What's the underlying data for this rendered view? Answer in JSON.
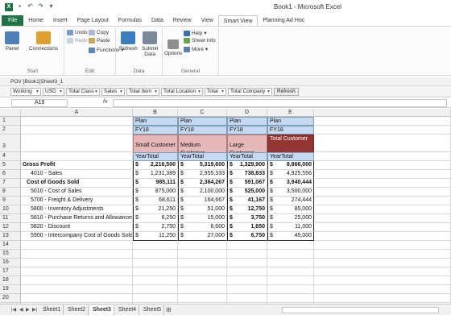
{
  "window": {
    "title": "Book1 - Microsoft Excel"
  },
  "ribbon_tabs": [
    "File",
    "Home",
    "Insert",
    "Page Layout",
    "Formulas",
    "Data",
    "Review",
    "View",
    "Smart View",
    "Planning Ad Hoc"
  ],
  "ribbon": {
    "start": {
      "label": "Start",
      "panel": "Panel",
      "connections": "Connections"
    },
    "edit": {
      "label": "Edit",
      "undo": "Undo",
      "redo": "Redo",
      "copy": "Copy",
      "paste": "Paste",
      "functions": "Functions"
    },
    "data": {
      "label": "Data",
      "refresh": "Refresh",
      "submit": "Submit",
      "submit2": "Data"
    },
    "general": {
      "label": "General",
      "options": "Options",
      "help": "Help",
      "sheet_info": "Sheet Info",
      "more": "More"
    }
  },
  "pov_label": "POV [Book1]Sheet3_1",
  "pov_dims": [
    "Working",
    "USD",
    "Total Class",
    "Sales",
    "Total Item",
    "Total Location",
    "Total",
    "Total Company"
  ],
  "pov_refresh": "Refresh",
  "name_box": "A19",
  "fx": "fx",
  "columns": [
    "A",
    "B",
    "C",
    "D",
    "E"
  ],
  "rows": [
    "1",
    "2",
    "3",
    "4",
    "5",
    "6",
    "7",
    "8",
    "9",
    "10",
    "11",
    "12",
    "13",
    "14",
    "15",
    "16",
    "17",
    "18",
    "19",
    "20",
    "21"
  ],
  "header": {
    "scenario": [
      "Plan",
      "Plan",
      "Plan",
      "Plan"
    ],
    "year": [
      "FY18",
      "FY18",
      "FY18",
      "FY18"
    ],
    "customer": [
      "Small Customer",
      "Medium Customer",
      "Large Customer",
      "Total Customer"
    ],
    "period": [
      "YearTotal",
      "YearTotal",
      "YearTotal",
      "YearTotal"
    ]
  },
  "data_rows": [
    {
      "label": "Gross Profit",
      "bold": true,
      "indent": 0,
      "values": [
        "2,216,500",
        "5,319,600",
        "1,329,900",
        "8,866,000"
      ]
    },
    {
      "label": "4010 - Sales",
      "bold": false,
      "indent": 2,
      "values": [
        "1,231,389",
        "2,955,333",
        "738,833",
        "4,925,556"
      ]
    },
    {
      "label": "Cost of Goods Sold",
      "bold": true,
      "indent": 1,
      "values": [
        "985,111",
        "2,364,267",
        "591,067",
        "3,940,444"
      ]
    },
    {
      "label": "5010 - Cost of Sales",
      "bold": false,
      "indent": 2,
      "values": [
        "875,000",
        "2,100,000",
        "525,000",
        "3,500,000"
      ]
    },
    {
      "label": "5700 - Freight & Delivery",
      "bold": false,
      "indent": 2,
      "values": [
        "68,611",
        "164,667",
        "41,167",
        "274,444"
      ]
    },
    {
      "label": "5800 - Inventory Adjustments",
      "bold": false,
      "indent": 2,
      "values": [
        "21,250",
        "51,000",
        "12,750",
        "85,000"
      ]
    },
    {
      "label": "5810 - Purchase Returns and Allowances",
      "bold": false,
      "indent": 2,
      "values": [
        "6,250",
        "15,000",
        "3,750",
        "25,000"
      ]
    },
    {
      "label": "5820 - Discount",
      "bold": false,
      "indent": 2,
      "values": [
        "2,750",
        "6,600",
        "1,650",
        "11,000"
      ]
    },
    {
      "label": "5900 - Intercompany Cost of Goods Sold",
      "bold": false,
      "indent": 2,
      "values": [
        "11,250",
        "27,000",
        "6,750",
        "45,000"
      ]
    }
  ],
  "currency_symbol": "$",
  "sheet_tabs": [
    "Sheet1",
    "Sheet2",
    "Sheet3",
    "Sheet4",
    "Sheet5"
  ],
  "active_sheet": "Sheet3",
  "colors": {
    "file_tab": "#217346",
    "plan_blue": "#c5d9f1",
    "customer_pink": "#e6b8b7",
    "total_red": "#963634"
  }
}
